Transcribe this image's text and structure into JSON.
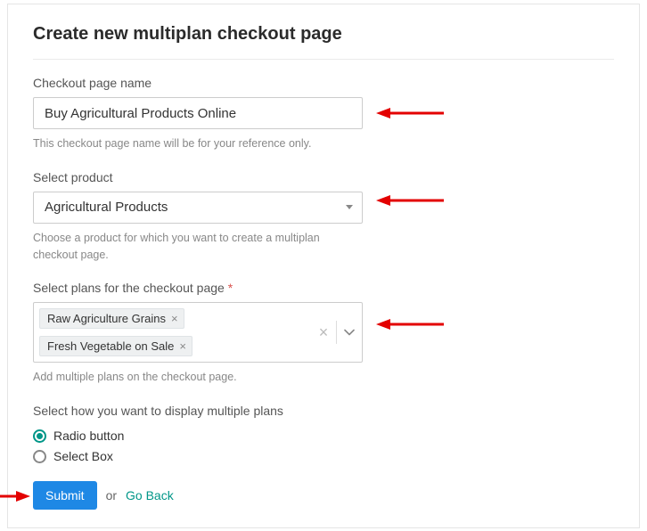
{
  "title": "Create new multiplan checkout page",
  "checkout_name": {
    "label": "Checkout page name",
    "value": "Buy Agricultural Products Online",
    "hint": "This checkout page name will be for your reference only."
  },
  "product": {
    "label": "Select product",
    "value": "Agricultural Products",
    "hint": "Choose a product for which you want to create a multiplan checkout page."
  },
  "plans": {
    "label": "Select plans for the checkout page",
    "required_mark": "*",
    "chips": [
      "Raw Agriculture Grains",
      "Fresh Vegetable on Sale"
    ],
    "hint": "Add multiple plans on the checkout page."
  },
  "display": {
    "label": "Select how you want to display multiple plans",
    "options": [
      {
        "label": "Radio button",
        "checked": true
      },
      {
        "label": "Select Box",
        "checked": false
      }
    ]
  },
  "actions": {
    "submit": "Submit",
    "or": "or",
    "go_back": "Go Back"
  }
}
